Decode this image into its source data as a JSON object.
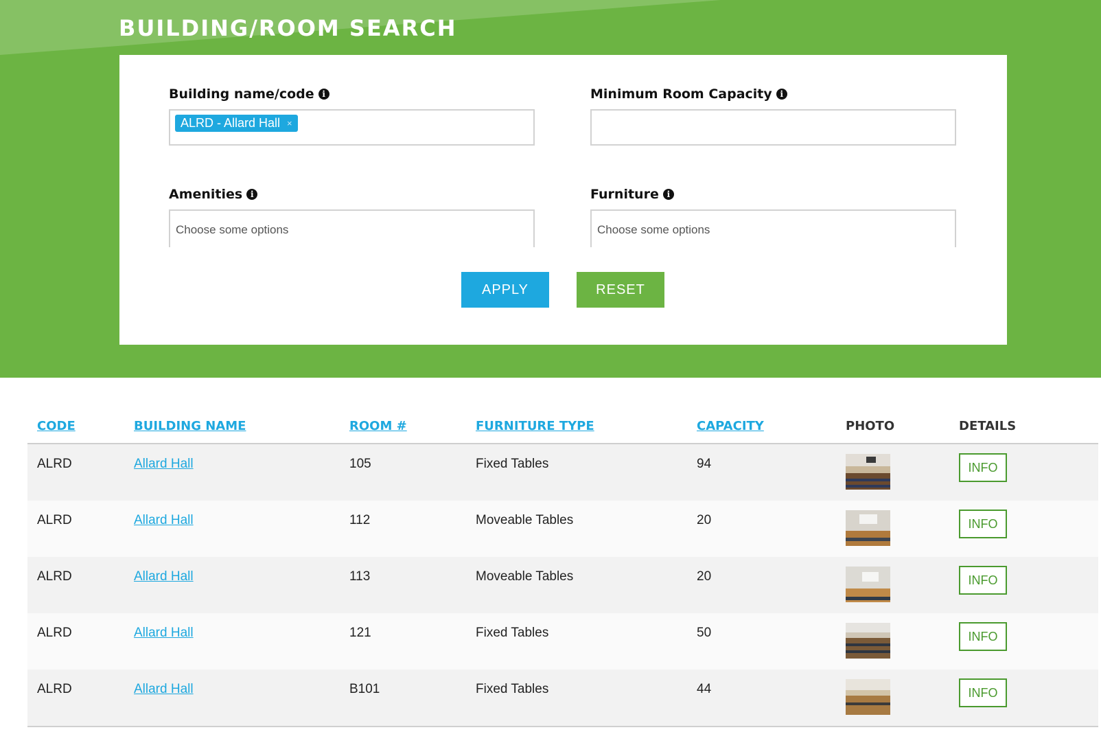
{
  "header": {
    "title": "BUILDING/ROOM SEARCH"
  },
  "form": {
    "building": {
      "label": "Building name/code",
      "chip": "ALRD - Allard Hall",
      "chip_remove": "×"
    },
    "capacity": {
      "label": "Minimum Room Capacity",
      "value": ""
    },
    "amenities": {
      "label": "Amenities",
      "placeholder": "Choose some options"
    },
    "furniture": {
      "label": "Furniture",
      "placeholder": "Choose some options"
    },
    "apply_label": "APPLY",
    "reset_label": "RESET",
    "info_glyph": "i"
  },
  "table": {
    "columns": [
      "CODE",
      "BUILDING NAME",
      "ROOM #",
      "FURNITURE TYPE",
      "CAPACITY",
      "PHOTO",
      "DETAILS"
    ],
    "rows": [
      {
        "code": "ALRD",
        "building": "Allard Hall",
        "room": "105",
        "furniture": "Fixed Tables",
        "capacity": "94",
        "details": "INFO"
      },
      {
        "code": "ALRD",
        "building": "Allard Hall",
        "room": "112",
        "furniture": "Moveable Tables",
        "capacity": "20",
        "details": "INFO"
      },
      {
        "code": "ALRD",
        "building": "Allard Hall",
        "room": "113",
        "furniture": "Moveable Tables",
        "capacity": "20",
        "details": "INFO"
      },
      {
        "code": "ALRD",
        "building": "Allard Hall",
        "room": "121",
        "furniture": "Fixed Tables",
        "capacity": "50",
        "details": "INFO"
      },
      {
        "code": "ALRD",
        "building": "Allard Hall",
        "room": "B101",
        "furniture": "Fixed Tables",
        "capacity": "44",
        "details": "INFO"
      }
    ]
  },
  "colors": {
    "brand_green": "#6cb443",
    "accent_blue": "#1ea8df",
    "info_green": "#4a9a2e"
  }
}
